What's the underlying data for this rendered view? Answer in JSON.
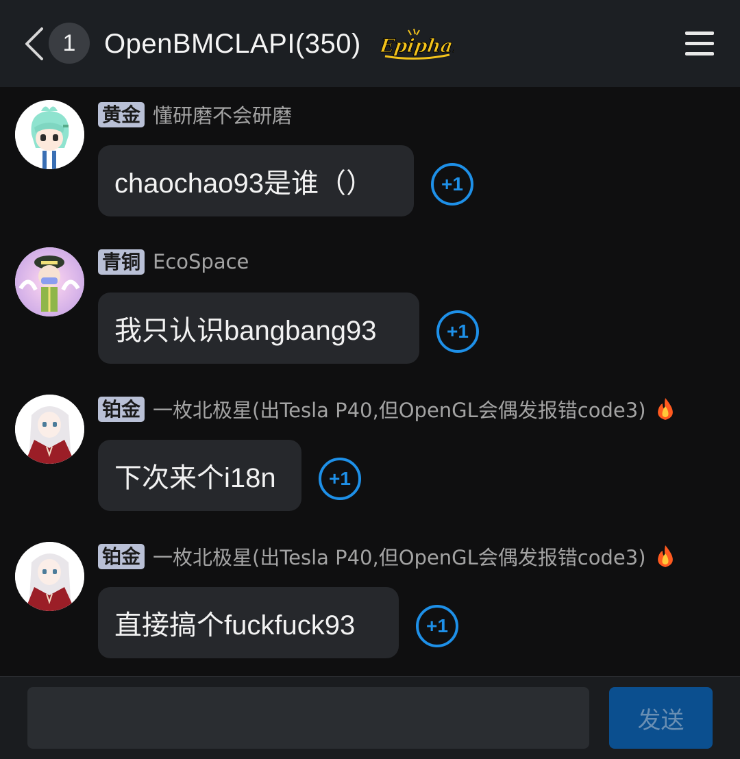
{
  "header": {
    "unread_count": "1",
    "title": "OpenBMCLAPI(350)",
    "logo_text": "Epiphany"
  },
  "messages": [
    {
      "rank": "黄金",
      "nickname": "懂研磨不会研磨",
      "text": "chaochao93是谁（）",
      "plus_label": "+1",
      "has_fire": false
    },
    {
      "rank": "青铜",
      "nickname": "EcoSpace",
      "text": "我只认识bangbang93",
      "plus_label": "+1",
      "has_fire": false
    },
    {
      "rank": "铂金",
      "nickname": "一枚北极星(出Tesla P40,但OpenGL会偶发报错code3)",
      "text": "下次来个i18n",
      "plus_label": "+1",
      "has_fire": true
    },
    {
      "rank": "铂金",
      "nickname": "一枚北极星(出Tesla P40,但OpenGL会偶发报错code3)",
      "text": "直接搞个fuckfuck93",
      "plus_label": "+1",
      "has_fire": true
    }
  ],
  "composer": {
    "input_value": "",
    "send_label": "发送"
  },
  "colors": {
    "header_bg": "#1c1f23",
    "body_bg": "#0f0f10",
    "bubble_bg": "#26282c",
    "accent": "#1e90e8",
    "rank_badge": "#b9c0d6",
    "send_bg": "#0b4f8f"
  },
  "icons": [
    "back-chevron-icon",
    "menu-icon",
    "fire-icon"
  ]
}
